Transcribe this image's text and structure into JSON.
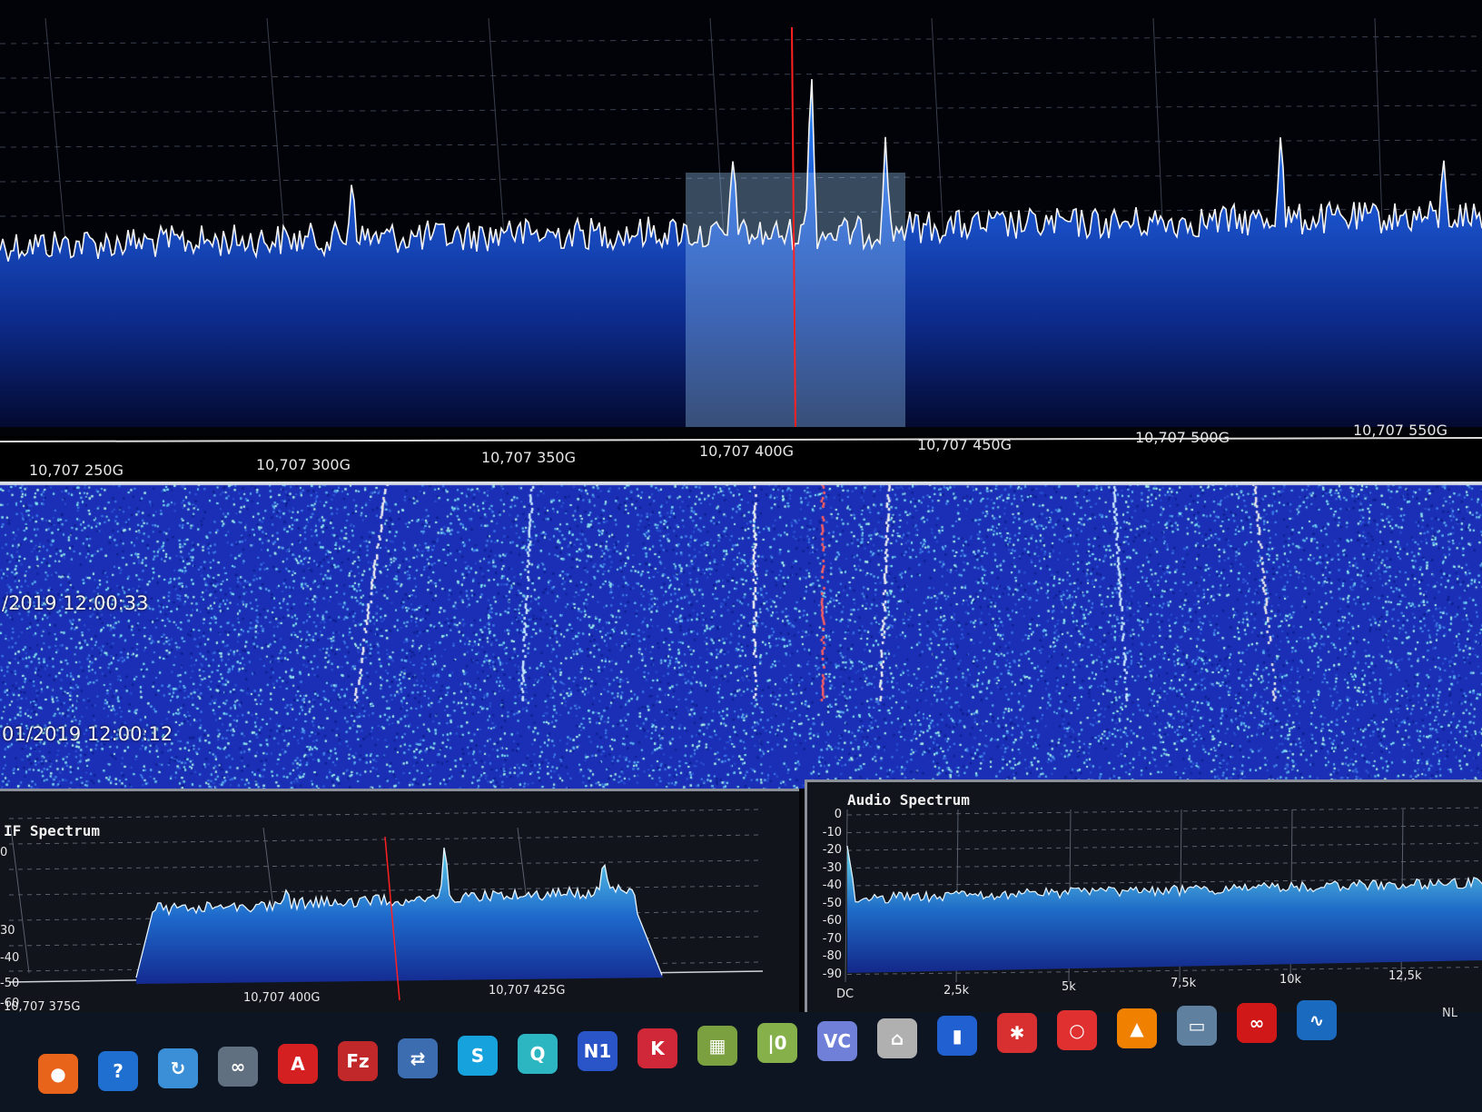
{
  "main_spectrum": {
    "freq_labels": [
      "10,707 250G",
      "10,707 300G",
      "10,707 350G",
      "10,707 400G",
      "10,707 450G",
      "10,707 500G",
      "10,707 550G"
    ],
    "accent_color": "#1e6ff0",
    "marker_color": "#ff2020"
  },
  "waterfall": {
    "timestamps": [
      "/2019 12:00:33",
      "01/2019 12:00:12"
    ],
    "background_color": "#1a2fb5"
  },
  "if_spectrum": {
    "title": "IF Spectrum",
    "y_ticks": [
      "0",
      "30",
      "-40",
      "-50",
      "-60"
    ],
    "x_ticks": [
      "10,707 375G",
      "10,707 400G",
      "10,707 425G"
    ]
  },
  "audio_spectrum": {
    "title": "Audio Spectrum",
    "y_ticks": [
      "0",
      "-10",
      "-20",
      "-30",
      "-40",
      "-50",
      "-60",
      "-70",
      "-80",
      "-90"
    ],
    "x_ticks": [
      "DC",
      "2,5k",
      "5k",
      "7,5k",
      "10k",
      "12,5k"
    ]
  },
  "taskbar": {
    "language": "NL",
    "icons": [
      {
        "name": "firefox-icon",
        "color": "#e8641a",
        "glyph": "●"
      },
      {
        "name": "help-icon",
        "color": "#1f6fd1",
        "glyph": "?"
      },
      {
        "name": "sync-icon",
        "color": "#3a8fd6",
        "glyph": "↻"
      },
      {
        "name": "network-icon",
        "color": "#607080",
        "glyph": "∞"
      },
      {
        "name": "acrobat-icon",
        "color": "#d42020",
        "glyph": "A"
      },
      {
        "name": "filezilla-icon",
        "color": "#c0282a",
        "glyph": "Fz"
      },
      {
        "name": "connection-icon",
        "color": "#3b6db0",
        "glyph": "⇄"
      },
      {
        "name": "skype-icon",
        "color": "#16a3dd",
        "glyph": "S"
      },
      {
        "name": "quicktime-icon",
        "color": "#2bb6c2",
        "glyph": "Q"
      },
      {
        "name": "n1mm-icon",
        "color": "#2a55c8",
        "glyph": "N1"
      },
      {
        "name": "qsl-icon",
        "color": "#d02838",
        "glyph": "K"
      },
      {
        "name": "chart-icon",
        "color": "#7aa040",
        "glyph": "▦"
      },
      {
        "name": "log-icon",
        "color": "#86b04a",
        "glyph": "|0"
      },
      {
        "name": "vc-icon",
        "color": "#7080d8",
        "glyph": "VC"
      },
      {
        "name": "tower-icon",
        "color": "#b0b0b0",
        "glyph": "⌂"
      },
      {
        "name": "flag-icon",
        "color": "#2060d0",
        "glyph": "▮"
      },
      {
        "name": "splash-icon",
        "color": "#d83030",
        "glyph": "✱"
      },
      {
        "name": "ring-icon",
        "color": "#e03030",
        "glyph": "○"
      },
      {
        "name": "vlc-icon",
        "color": "#f08000",
        "glyph": "▲"
      },
      {
        "name": "photo-icon",
        "color": "#6080a0",
        "glyph": "▭"
      },
      {
        "name": "creative-cloud-icon",
        "color": "#d01818",
        "glyph": "∞"
      },
      {
        "name": "sdr-icon",
        "color": "#1a6ac0",
        "glyph": "∿"
      }
    ]
  }
}
